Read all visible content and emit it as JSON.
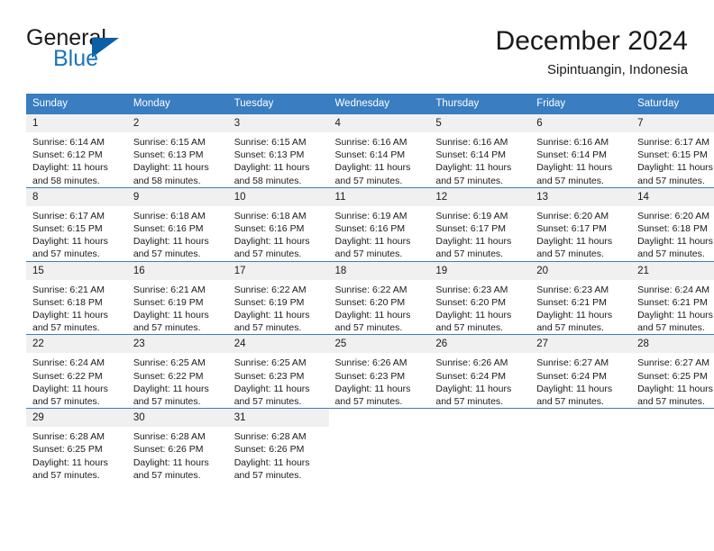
{
  "brand": {
    "word_general": "General",
    "word_blue": "Blue",
    "triangle_color": "#0b5fa4",
    "blue_text_color": "#1b75bb"
  },
  "header": {
    "title": "December 2024",
    "location": "Sipintuangin, Indonesia"
  },
  "theme": {
    "header_row_bg": "#3a7dc1",
    "header_row_text": "#ffffff",
    "daynum_bg": "#f0f0f0",
    "body_text": "#1a1a1a",
    "page_bg": "#ffffff"
  },
  "weekday_headers": [
    "Sunday",
    "Monday",
    "Tuesday",
    "Wednesday",
    "Thursday",
    "Friday",
    "Saturday"
  ],
  "weeks": [
    [
      {
        "day": "1",
        "sunrise": "Sunrise: 6:14 AM",
        "sunset": "Sunset: 6:12 PM",
        "daylight": "Daylight: 11 hours and 58 minutes."
      },
      {
        "day": "2",
        "sunrise": "Sunrise: 6:15 AM",
        "sunset": "Sunset: 6:13 PM",
        "daylight": "Daylight: 11 hours and 58 minutes."
      },
      {
        "day": "3",
        "sunrise": "Sunrise: 6:15 AM",
        "sunset": "Sunset: 6:13 PM",
        "daylight": "Daylight: 11 hours and 58 minutes."
      },
      {
        "day": "4",
        "sunrise": "Sunrise: 6:16 AM",
        "sunset": "Sunset: 6:14 PM",
        "daylight": "Daylight: 11 hours and 57 minutes."
      },
      {
        "day": "5",
        "sunrise": "Sunrise: 6:16 AM",
        "sunset": "Sunset: 6:14 PM",
        "daylight": "Daylight: 11 hours and 57 minutes."
      },
      {
        "day": "6",
        "sunrise": "Sunrise: 6:16 AM",
        "sunset": "Sunset: 6:14 PM",
        "daylight": "Daylight: 11 hours and 57 minutes."
      },
      {
        "day": "7",
        "sunrise": "Sunrise: 6:17 AM",
        "sunset": "Sunset: 6:15 PM",
        "daylight": "Daylight: 11 hours and 57 minutes."
      }
    ],
    [
      {
        "day": "8",
        "sunrise": "Sunrise: 6:17 AM",
        "sunset": "Sunset: 6:15 PM",
        "daylight": "Daylight: 11 hours and 57 minutes."
      },
      {
        "day": "9",
        "sunrise": "Sunrise: 6:18 AM",
        "sunset": "Sunset: 6:16 PM",
        "daylight": "Daylight: 11 hours and 57 minutes."
      },
      {
        "day": "10",
        "sunrise": "Sunrise: 6:18 AM",
        "sunset": "Sunset: 6:16 PM",
        "daylight": "Daylight: 11 hours and 57 minutes."
      },
      {
        "day": "11",
        "sunrise": "Sunrise: 6:19 AM",
        "sunset": "Sunset: 6:16 PM",
        "daylight": "Daylight: 11 hours and 57 minutes."
      },
      {
        "day": "12",
        "sunrise": "Sunrise: 6:19 AM",
        "sunset": "Sunset: 6:17 PM",
        "daylight": "Daylight: 11 hours and 57 minutes."
      },
      {
        "day": "13",
        "sunrise": "Sunrise: 6:20 AM",
        "sunset": "Sunset: 6:17 PM",
        "daylight": "Daylight: 11 hours and 57 minutes."
      },
      {
        "day": "14",
        "sunrise": "Sunrise: 6:20 AM",
        "sunset": "Sunset: 6:18 PM",
        "daylight": "Daylight: 11 hours and 57 minutes."
      }
    ],
    [
      {
        "day": "15",
        "sunrise": "Sunrise: 6:21 AM",
        "sunset": "Sunset: 6:18 PM",
        "daylight": "Daylight: 11 hours and 57 minutes."
      },
      {
        "day": "16",
        "sunrise": "Sunrise: 6:21 AM",
        "sunset": "Sunset: 6:19 PM",
        "daylight": "Daylight: 11 hours and 57 minutes."
      },
      {
        "day": "17",
        "sunrise": "Sunrise: 6:22 AM",
        "sunset": "Sunset: 6:19 PM",
        "daylight": "Daylight: 11 hours and 57 minutes."
      },
      {
        "day": "18",
        "sunrise": "Sunrise: 6:22 AM",
        "sunset": "Sunset: 6:20 PM",
        "daylight": "Daylight: 11 hours and 57 minutes."
      },
      {
        "day": "19",
        "sunrise": "Sunrise: 6:23 AM",
        "sunset": "Sunset: 6:20 PM",
        "daylight": "Daylight: 11 hours and 57 minutes."
      },
      {
        "day": "20",
        "sunrise": "Sunrise: 6:23 AM",
        "sunset": "Sunset: 6:21 PM",
        "daylight": "Daylight: 11 hours and 57 minutes."
      },
      {
        "day": "21",
        "sunrise": "Sunrise: 6:24 AM",
        "sunset": "Sunset: 6:21 PM",
        "daylight": "Daylight: 11 hours and 57 minutes."
      }
    ],
    [
      {
        "day": "22",
        "sunrise": "Sunrise: 6:24 AM",
        "sunset": "Sunset: 6:22 PM",
        "daylight": "Daylight: 11 hours and 57 minutes."
      },
      {
        "day": "23",
        "sunrise": "Sunrise: 6:25 AM",
        "sunset": "Sunset: 6:22 PM",
        "daylight": "Daylight: 11 hours and 57 minutes."
      },
      {
        "day": "24",
        "sunrise": "Sunrise: 6:25 AM",
        "sunset": "Sunset: 6:23 PM",
        "daylight": "Daylight: 11 hours and 57 minutes."
      },
      {
        "day": "25",
        "sunrise": "Sunrise: 6:26 AM",
        "sunset": "Sunset: 6:23 PM",
        "daylight": "Daylight: 11 hours and 57 minutes."
      },
      {
        "day": "26",
        "sunrise": "Sunrise: 6:26 AM",
        "sunset": "Sunset: 6:24 PM",
        "daylight": "Daylight: 11 hours and 57 minutes."
      },
      {
        "day": "27",
        "sunrise": "Sunrise: 6:27 AM",
        "sunset": "Sunset: 6:24 PM",
        "daylight": "Daylight: 11 hours and 57 minutes."
      },
      {
        "day": "28",
        "sunrise": "Sunrise: 6:27 AM",
        "sunset": "Sunset: 6:25 PM",
        "daylight": "Daylight: 11 hours and 57 minutes."
      }
    ],
    [
      {
        "day": "29",
        "sunrise": "Sunrise: 6:28 AM",
        "sunset": "Sunset: 6:25 PM",
        "daylight": "Daylight: 11 hours and 57 minutes."
      },
      {
        "day": "30",
        "sunrise": "Sunrise: 6:28 AM",
        "sunset": "Sunset: 6:26 PM",
        "daylight": "Daylight: 11 hours and 57 minutes."
      },
      {
        "day": "31",
        "sunrise": "Sunrise: 6:28 AM",
        "sunset": "Sunset: 6:26 PM",
        "daylight": "Daylight: 11 hours and 57 minutes."
      },
      {
        "day": "",
        "sunrise": "",
        "sunset": "",
        "daylight": ""
      },
      {
        "day": "",
        "sunrise": "",
        "sunset": "",
        "daylight": ""
      },
      {
        "day": "",
        "sunrise": "",
        "sunset": "",
        "daylight": ""
      },
      {
        "day": "",
        "sunrise": "",
        "sunset": "",
        "daylight": ""
      }
    ]
  ]
}
